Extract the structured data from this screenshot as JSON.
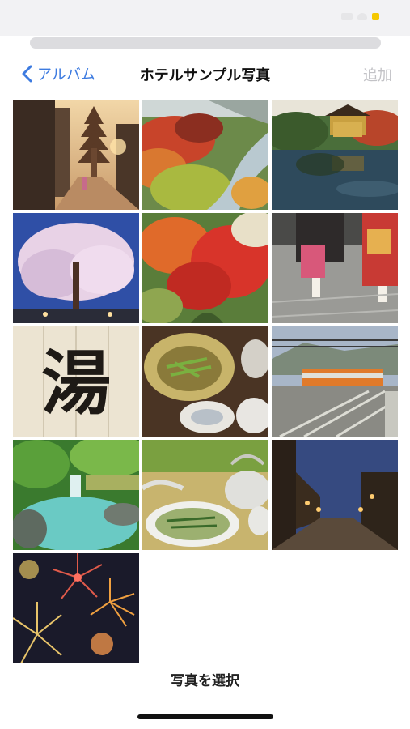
{
  "nav": {
    "back_label": "アルバム",
    "title": "ホテルサンプル写真",
    "add_label": "追加"
  },
  "photos": [
    {
      "subject": "pagoda street at dusk"
    },
    {
      "subject": "autumn river valley"
    },
    {
      "subject": "golden pavilion"
    },
    {
      "subject": "weeping cherry tree"
    },
    {
      "subject": "red maple leaves"
    },
    {
      "subject": "kimono walkers"
    },
    {
      "subject": "noren curtain",
      "text": "湯"
    },
    {
      "subject": "kaiseki dishes"
    },
    {
      "subject": "orange train"
    },
    {
      "subject": "outdoor hot spring"
    },
    {
      "subject": "tea and soup"
    },
    {
      "subject": "old town night street"
    },
    {
      "subject": "fireworks"
    }
  ],
  "footer": {
    "select_label": "写真を選択"
  },
  "colors": {
    "accent": "#3d7be0",
    "disabled": "#c2c2c6"
  }
}
